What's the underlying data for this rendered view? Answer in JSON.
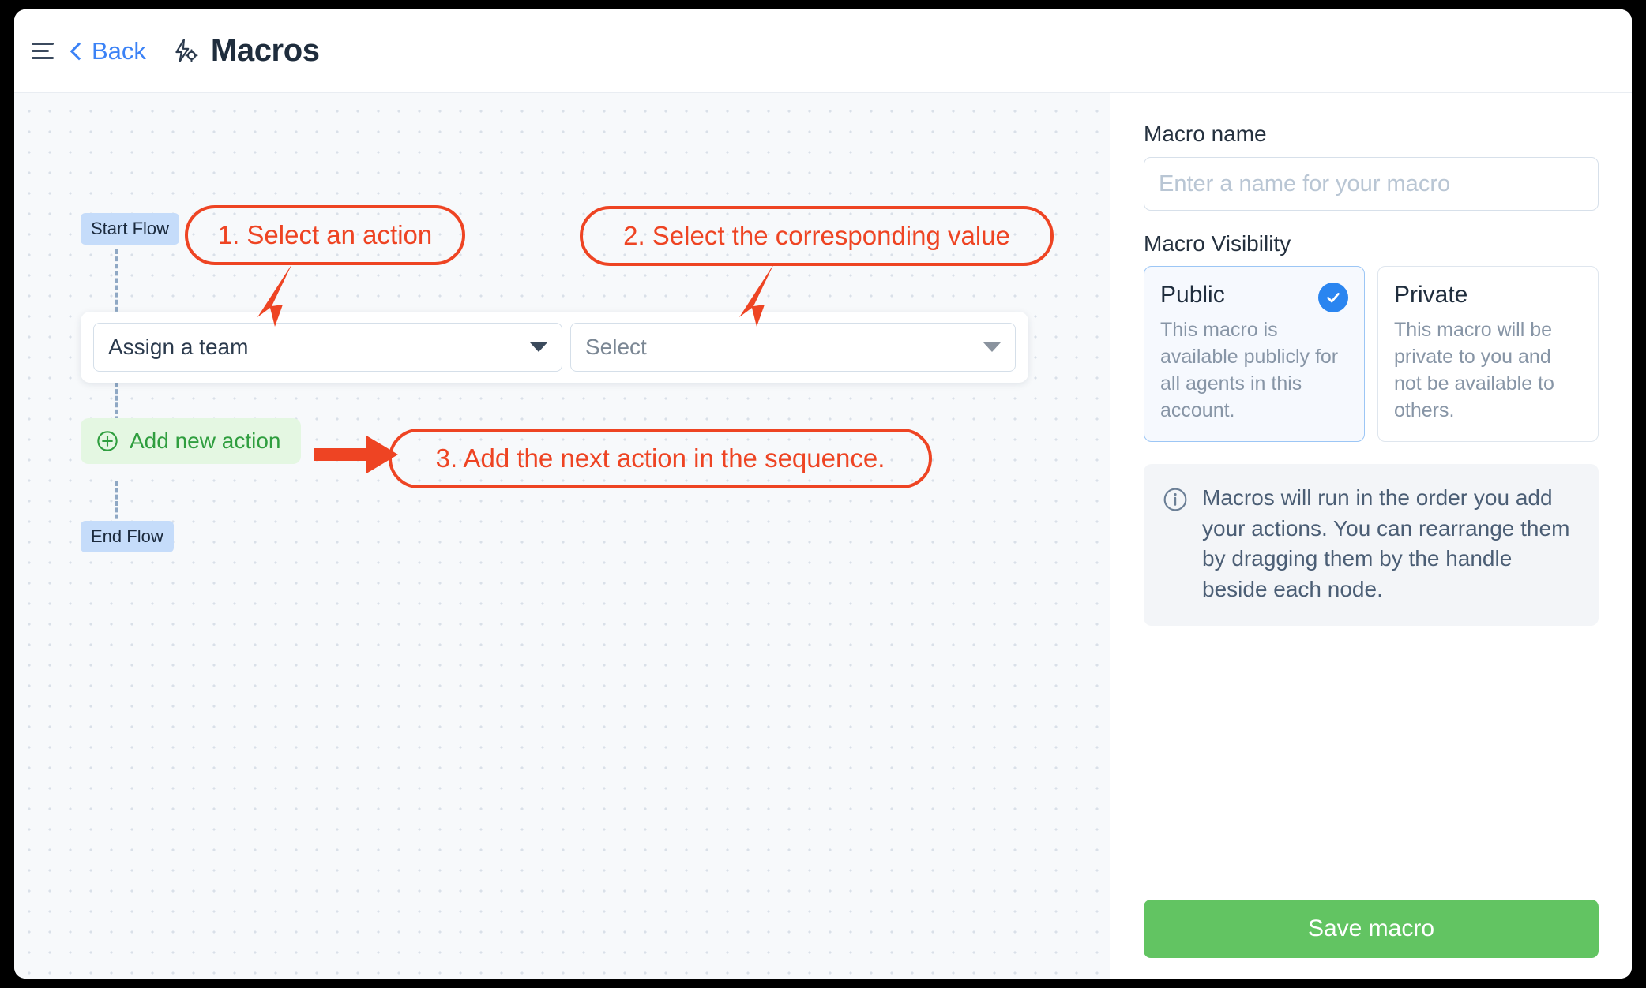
{
  "header": {
    "menu_icon": "hamburger-icon",
    "back_label": "Back",
    "macro_icon": "macro-bolt-gear-icon",
    "title": "Macros"
  },
  "canvas": {
    "start_flow_label": "Start Flow",
    "end_flow_label": "End Flow",
    "action_select": {
      "value": "Assign a team",
      "chevron": "chevron-down-icon"
    },
    "value_select": {
      "placeholder": "Select",
      "chevron": "chevron-down-icon"
    },
    "add_action": {
      "icon": "plus-circle-icon",
      "label": "Add new action"
    },
    "annotations": [
      {
        "text": "1. Select an action"
      },
      {
        "text": "2. Select the corresponding value"
      },
      {
        "text": "3. Add the next action in the sequence."
      }
    ]
  },
  "panel": {
    "macro_name_label": "Macro name",
    "macro_name_value": "",
    "macro_name_placeholder": "Enter a name for your macro",
    "visibility_label": "Macro Visibility",
    "visibility_options": [
      {
        "title": "Public",
        "description": "This macro is available publicly for all agents in this account.",
        "selected": true,
        "check_icon": "check-circle-icon"
      },
      {
        "title": "Private",
        "description": "This macro will be private to you and not be available to others.",
        "selected": false
      }
    ],
    "info": {
      "icon": "info-circle-icon",
      "text": "Macros will run in the order you add your actions. You can rearrange them by dragging them by the handle beside each node."
    },
    "save_label": "Save macro"
  },
  "colors": {
    "accent_blue": "#3b82f6",
    "annotation_red": "#ee4423",
    "save_green": "#62c462",
    "add_action_green": "#2f9e3f",
    "flow_badge_blue": "#c5dcfa"
  }
}
